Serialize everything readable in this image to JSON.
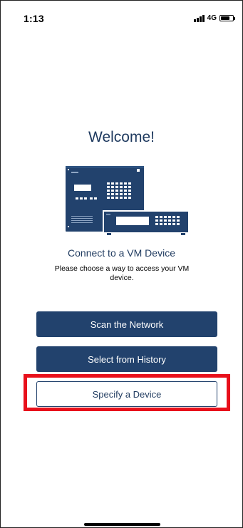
{
  "status_bar": {
    "time": "1:13",
    "network": "4G",
    "signal_bars": 4,
    "battery_level": 0.75,
    "icons": [
      "signal-icon",
      "battery-icon"
    ]
  },
  "welcome": {
    "title": "Welcome!"
  },
  "device_image": {
    "icon": "vm-device-illustration"
  },
  "connect": {
    "title": "Connect to a VM Device",
    "description": "Please choose a way to access your VM device."
  },
  "actions": {
    "scan_label": "Scan the Network",
    "history_label": "Select from History",
    "specify_label": "Specify a Device"
  },
  "colors": {
    "primary": "#22426d",
    "text_accent": "#1f3a5f",
    "highlight": "#e8101b"
  }
}
